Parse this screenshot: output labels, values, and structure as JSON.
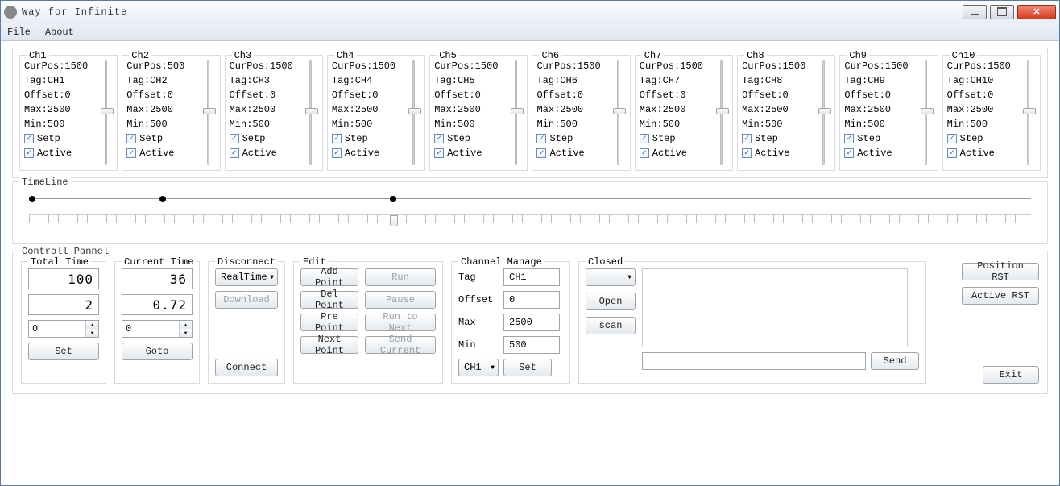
{
  "window": {
    "title": "Way for Infinite"
  },
  "menu": {
    "file": "File",
    "about": "About"
  },
  "channels": [
    {
      "name": "Ch1",
      "cur": "CurPos:1500",
      "tag": "Tag:CH1",
      "off": "Offset:0",
      "max": "Max:2500",
      "min": "Min:500",
      "step_lbl": "Setp",
      "active_lbl": "Active"
    },
    {
      "name": "Ch2",
      "cur": "CurPos:500",
      "tag": "Tag:CH2",
      "off": "Offset:0",
      "max": "Max:2500",
      "min": "Min:500",
      "step_lbl": "Setp",
      "active_lbl": "Active"
    },
    {
      "name": "Ch3",
      "cur": "CurPos:1500",
      "tag": "Tag:CH3",
      "off": "Offset:0",
      "max": "Max:2500",
      "min": "Min:500",
      "step_lbl": "Setp",
      "active_lbl": "Active"
    },
    {
      "name": "Ch4",
      "cur": "CurPos:1500",
      "tag": "Tag:CH4",
      "off": "Offset:0",
      "max": "Max:2500",
      "min": "Min:500",
      "step_lbl": "Step",
      "active_lbl": "Active"
    },
    {
      "name": "Ch5",
      "cur": "CurPos:1500",
      "tag": "Tag:CH5",
      "off": "Offset:0",
      "max": "Max:2500",
      "min": "Min:500",
      "step_lbl": "Step",
      "active_lbl": "Active"
    },
    {
      "name": "Ch6",
      "cur": "CurPos:1500",
      "tag": "Tag:CH6",
      "off": "Offset:0",
      "max": "Max:2500",
      "min": "Min:500",
      "step_lbl": "Step",
      "active_lbl": "Active"
    },
    {
      "name": "Ch7",
      "cur": "CurPos:1500",
      "tag": "Tag:CH7",
      "off": "Offset:0",
      "max": "Max:2500",
      "min": "Min:500",
      "step_lbl": "Step",
      "active_lbl": "Active"
    },
    {
      "name": "Ch8",
      "cur": "CurPos:1500",
      "tag": "Tag:CH8",
      "off": "Offset:0",
      "max": "Max:2500",
      "min": "Min:500",
      "step_lbl": "Step",
      "active_lbl": "Active"
    },
    {
      "name": "Ch9",
      "cur": "CurPos:1500",
      "tag": "Tag:CH9",
      "off": "Offset:0",
      "max": "Max:2500",
      "min": "Min:500",
      "step_lbl": "Step",
      "active_lbl": "Active"
    },
    {
      "name": "Ch10",
      "cur": "CurPos:1500",
      "tag": "Tag:CH10",
      "off": "Offset:0",
      "max": "Max:2500",
      "min": "Min:500",
      "step_lbl": "Step",
      "active_lbl": "Active"
    }
  ],
  "timeline": {
    "label": "TimeLine"
  },
  "control_panel": {
    "label": "Controll Pannel"
  },
  "total_time": {
    "label": "Total Time",
    "v1": "100",
    "v2": "2",
    "spin": "0",
    "set": "Set"
  },
  "current_time": {
    "label": "Current Time",
    "v1": "36",
    "v2": "0.72",
    "spin": "0",
    "goto": "Goto"
  },
  "disconnect": {
    "label": "Disconnect",
    "mode": "RealTime",
    "download": "Download",
    "connect": "Connect"
  },
  "edit": {
    "label": "Edit",
    "add": "Add Point",
    "run": "Run",
    "del": "Del Point",
    "pause": "Pause",
    "pre": "Pre Point",
    "runnext": "Run to Next",
    "next": "Next Point",
    "sendcur": "Send Current"
  },
  "channel_manage": {
    "label": "Channel Manage",
    "tag_lbl": "Tag",
    "tag_val": "CH1",
    "off_lbl": "Offset",
    "off_val": "0",
    "max_lbl": "Max",
    "max_val": "2500",
    "min_lbl": "Min",
    "min_val": "500",
    "sel": "CH1",
    "set": "Set"
  },
  "closed": {
    "label": "Closed",
    "open": "Open",
    "scan": "scan",
    "send": "Send"
  },
  "right": {
    "pos": "Position RST",
    "act": "Active RST",
    "exit": "Exit"
  }
}
